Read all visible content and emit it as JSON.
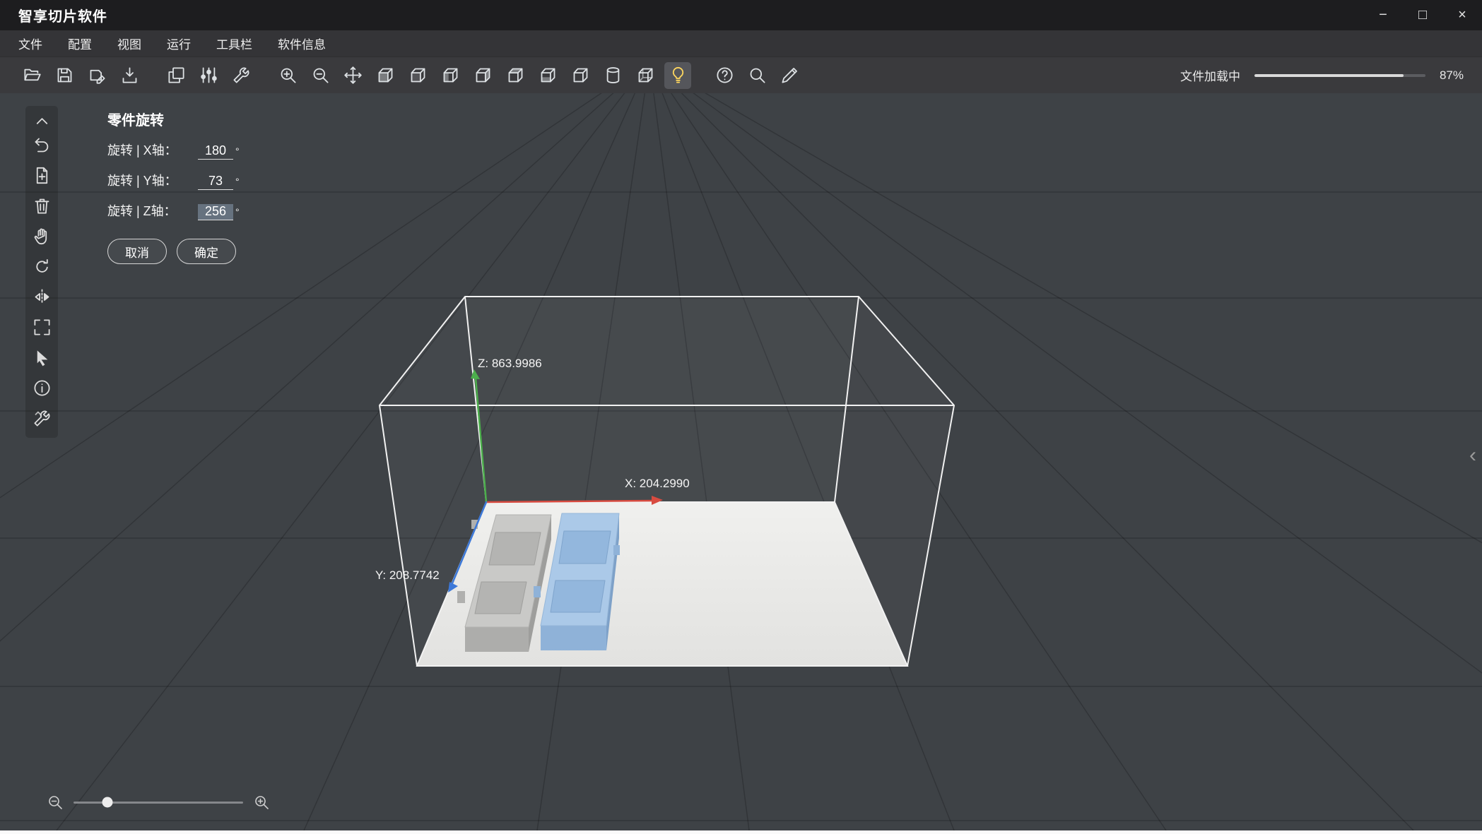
{
  "window": {
    "title": "智享切片软件"
  },
  "window_controls": {
    "minimize": "−",
    "maximize": "□",
    "close": "×"
  },
  "menu": {
    "items": [
      {
        "id": "file",
        "label": "文件"
      },
      {
        "id": "config",
        "label": "配置"
      },
      {
        "id": "view",
        "label": "视图"
      },
      {
        "id": "run",
        "label": "运行"
      },
      {
        "id": "toolbar",
        "label": "工具栏"
      },
      {
        "id": "software-info",
        "label": "软件信息"
      }
    ]
  },
  "toolbar": {
    "groups": [
      [
        "open-file",
        "save",
        "save-as",
        "import-model"
      ],
      [
        "duplicate",
        "adjust-params",
        "machine-tools"
      ],
      [
        "zoom-in",
        "zoom-out",
        "move-model",
        "view-front",
        "view-back",
        "view-left",
        "view-right",
        "view-top",
        "view-bottom",
        "view-iso",
        "cylinder-view",
        "wireframe-view",
        "light"
      ],
      [
        "help",
        "probe",
        "annotate-pen"
      ]
    ],
    "active_icon": "light",
    "progress": {
      "label": "文件加载中",
      "percent": 87,
      "percent_label": "87%"
    }
  },
  "sidebar": {
    "items": [
      "collapse",
      "undo",
      "add-model",
      "delete-model",
      "pan",
      "rotate-view",
      "mirror",
      "fit-view",
      "select",
      "info",
      "repair"
    ]
  },
  "rotation_panel": {
    "title": "零件旋转",
    "rows": [
      {
        "label": "旋转 | X轴：",
        "value": "180",
        "unit": "°",
        "selected": false
      },
      {
        "label": "旋转 | Y轴：",
        "value": "73",
        "unit": "°",
        "selected": false
      },
      {
        "label": "旋转 | Z轴：",
        "value": "256",
        "unit": "°",
        "selected": true
      }
    ],
    "cancel_label": "取消",
    "confirm_label": "确定"
  },
  "viewport": {
    "axes": {
      "x": {
        "label": "X: 204.2990",
        "color": "#d84b40"
      },
      "y": {
        "label": "Y: 208.7742",
        "color": "#3c78d8"
      },
      "z": {
        "label": "Z: 863.9986",
        "color": "#4cae4c"
      }
    },
    "models": [
      {
        "name": "model-gray",
        "color": "#c9c9c7"
      },
      {
        "name": "model-blue",
        "color": "#abc9e8"
      }
    ]
  },
  "zoom_slider": {
    "value_percent": 20
  },
  "edge_chevron": "‹"
}
